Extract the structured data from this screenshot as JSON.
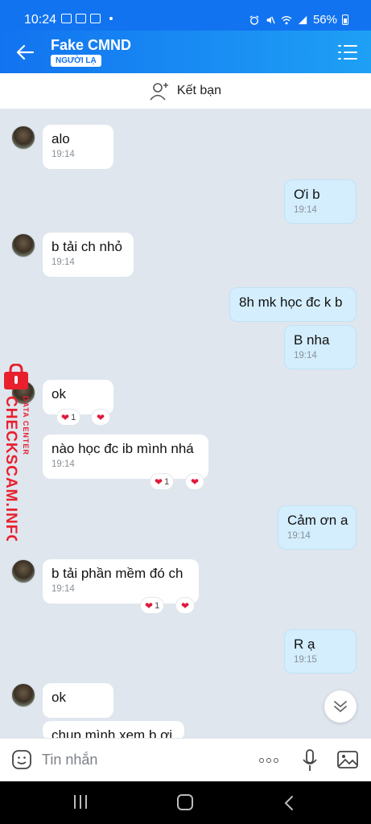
{
  "status_bar": {
    "time": "10:24",
    "battery": "56%"
  },
  "header": {
    "title": "Fake CMND",
    "badge": "NGƯỜI LẠ"
  },
  "friend_bar": {
    "label": "Kết bạn"
  },
  "messages": [
    {
      "side": "in",
      "text": "alo",
      "time": "19:14"
    },
    {
      "side": "out",
      "text": "Ơi b",
      "time": "19:14"
    },
    {
      "side": "in",
      "text": "b tải ch nhỏ",
      "time": "19:14"
    },
    {
      "side": "out",
      "text": "8h mk học đc k b",
      "time": ""
    },
    {
      "side": "out",
      "text": "B nha",
      "time": "19:14"
    },
    {
      "side": "in",
      "text": "ok",
      "time": "",
      "reaction_count": "1"
    },
    {
      "side": "in",
      "text": "nào học đc ib mình nhá",
      "time": "19:14",
      "reaction_count": "1"
    },
    {
      "side": "out",
      "text": "Cảm ơn a",
      "time": "19:14"
    },
    {
      "side": "in",
      "text": "b tải phần mềm đó ch",
      "time": "19:14",
      "reaction_count": "1"
    },
    {
      "side": "out",
      "text": "R ạ",
      "time": "19:15"
    },
    {
      "side": "in",
      "text": "ok",
      "time": ""
    },
    {
      "side": "in",
      "text": "chụp mình xem b ơi",
      "time": ""
    }
  ],
  "watermark": {
    "brand": "CHECKSCAM.INFO",
    "sub": "DATA CENTER"
  },
  "input": {
    "placeholder": "Tin nhắn"
  },
  "colors": {
    "header": "#1273f0",
    "outgoing_bubble": "#d4eefe",
    "background": "#dfe6ee",
    "heart": "#e0193c"
  }
}
